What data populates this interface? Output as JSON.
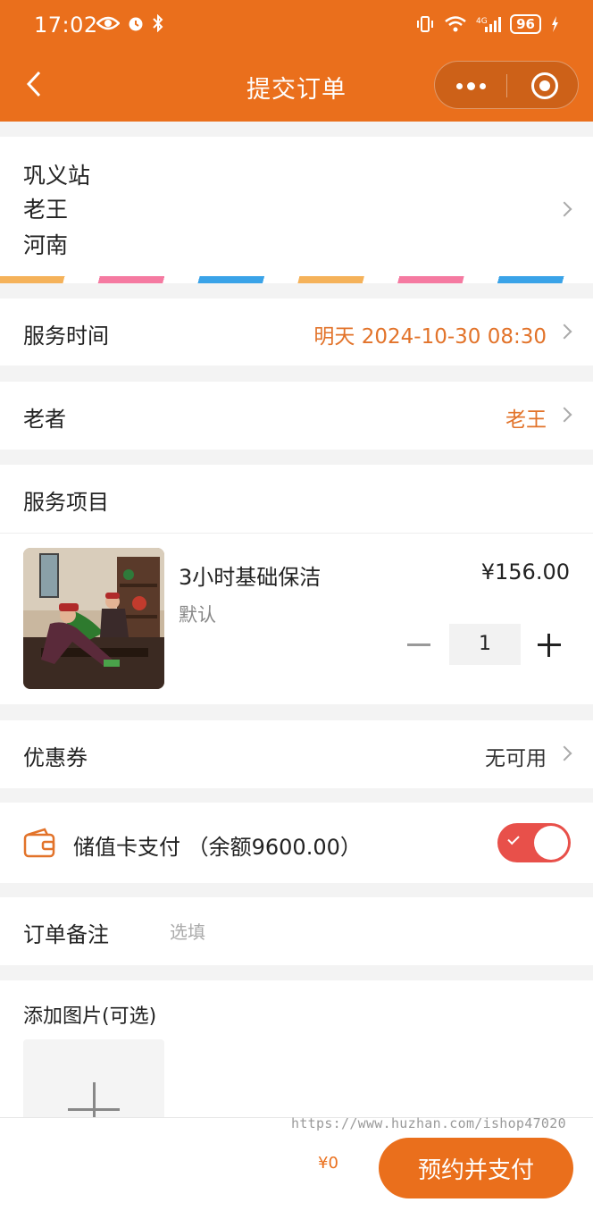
{
  "status_bar": {
    "time": "17:02",
    "battery": "96"
  },
  "nav": {
    "title": "提交订单"
  },
  "address": {
    "line1": "巩义站",
    "line2": "老王",
    "line3": "河南"
  },
  "service_time": {
    "label": "服务时间",
    "value": "明天 2024-10-30 08:30"
  },
  "elder": {
    "label": "老者",
    "value": "老王"
  },
  "service": {
    "section_title": "服务项目",
    "item": {
      "name": "3小时基础保洁",
      "spec": "默认",
      "price": "¥156.00",
      "quantity": "1"
    }
  },
  "coupon": {
    "label": "优惠券",
    "value": "无可用"
  },
  "card_pay": {
    "label": "储值卡支付 （余额9600.00）",
    "enabled": true
  },
  "remark": {
    "label": "订单备注",
    "placeholder": "选填"
  },
  "images": {
    "label": "添加图片(可选)"
  },
  "footer": {
    "watermark": "https://www.huzhan.com/ishop47020",
    "total": "¥0",
    "pay_button": "预约并支付"
  },
  "colors": {
    "primary": "#ea6f1c",
    "accent_text": "#e2732a",
    "toggle_on": "#e8504a"
  }
}
